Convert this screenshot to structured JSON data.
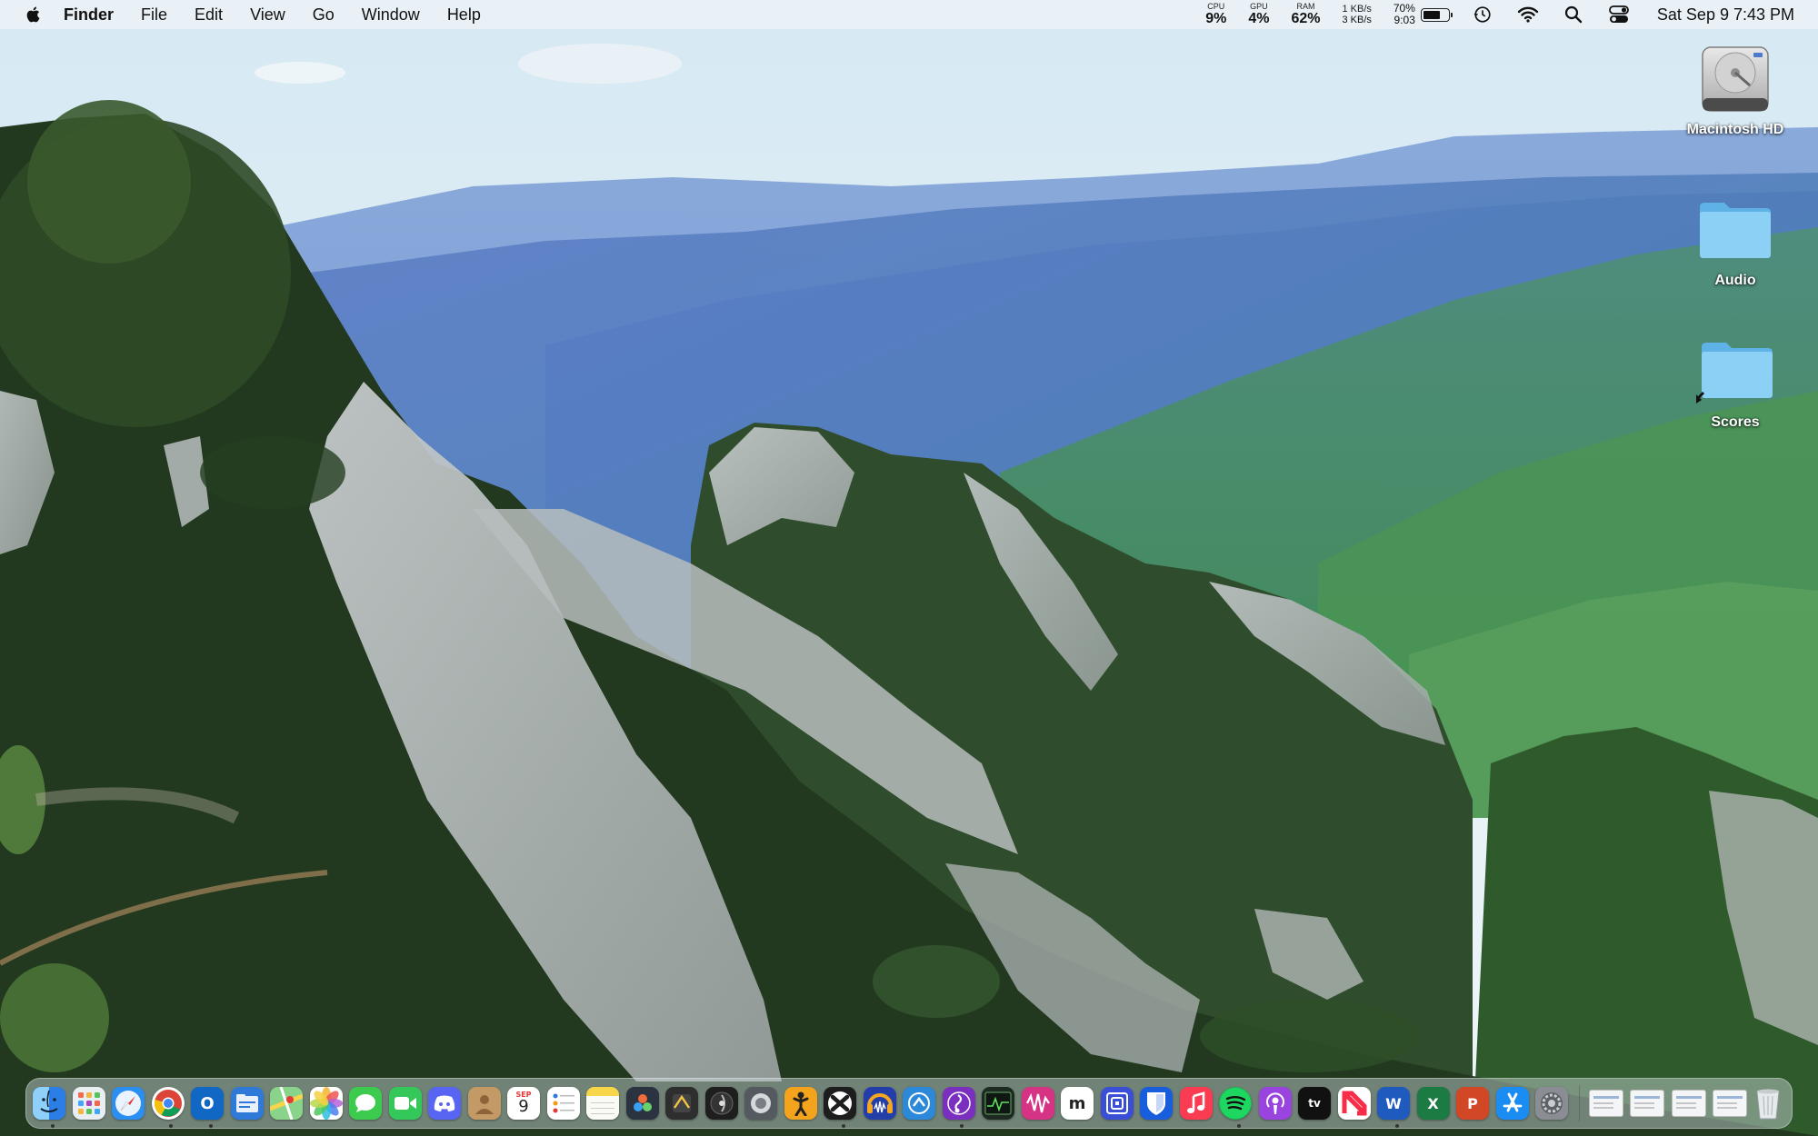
{
  "menubar": {
    "app_name": "Finder",
    "menus": [
      "File",
      "Edit",
      "View",
      "Go",
      "Window",
      "Help"
    ],
    "stats": {
      "cpu_label": "CPU",
      "cpu_value": "9%",
      "gpu_label": "GPU",
      "gpu_value": "4%",
      "ram_label": "RAM",
      "ram_value": "62%",
      "net_up": "1 KB/s",
      "net_down": "3 KB/s",
      "battery_percent": "70%",
      "battery_time": "9:03",
      "battery_level": 0.7
    },
    "icons": [
      "apple-icon",
      "time-machine-icon",
      "wifi-icon",
      "spotlight-search-icon",
      "control-center-icon"
    ],
    "clock": "Sat Sep 9  7:43 PM"
  },
  "desktop": {
    "icons": [
      {
        "label": "Macintosh HD",
        "icon": "hard-drive-icon"
      },
      {
        "label": "Audio",
        "icon": "folder-icon"
      },
      {
        "label": "Scores",
        "icon": "folder-alias-icon"
      }
    ]
  },
  "calendar": {
    "month": "SEP",
    "day": "9"
  },
  "dock": {
    "apps": [
      {
        "name": "finder",
        "icon": "finder-icon",
        "color": "#3d8ce8",
        "running": true
      },
      {
        "name": "launchpad",
        "icon": "launchpad-icon",
        "color": "#e9eef3",
        "running": false
      },
      {
        "name": "safari",
        "icon": "safari-icon",
        "color": "#2a8ff0",
        "running": false
      },
      {
        "name": "chrome",
        "icon": "chrome-icon",
        "color": "#ffffff",
        "running": true
      },
      {
        "name": "outlook",
        "icon": "outlook-icon",
        "color": "#1068c4",
        "running": true
      },
      {
        "name": "files",
        "icon": "files-icon",
        "color": "#2f7ad8",
        "running": false
      },
      {
        "name": "maps",
        "icon": "maps-icon",
        "color": "#6ec06a",
        "running": false
      },
      {
        "name": "photos",
        "icon": "photos-icon",
        "color": "#ffffff",
        "running": false
      },
      {
        "name": "messages",
        "icon": "messages-icon",
        "color": "#3ccb4e",
        "running": false
      },
      {
        "name": "facetime",
        "icon": "facetime-icon",
        "color": "#34c759",
        "running": false
      },
      {
        "name": "discord",
        "icon": "discord-icon",
        "color": "#5865f2",
        "running": false
      },
      {
        "name": "contacts",
        "icon": "contacts-icon",
        "color": "#b88952",
        "running": false
      },
      {
        "name": "calendar",
        "icon": "calendar-icon",
        "color": "#ffffff",
        "running": false
      },
      {
        "name": "reminders",
        "icon": "reminders-icon",
        "color": "#ffffff",
        "running": false
      },
      {
        "name": "notes",
        "icon": "notes-icon",
        "color": "#f7d64a",
        "running": false
      },
      {
        "name": "davinci-resolve",
        "icon": "davinci-resolve-icon",
        "color": "#2b3340",
        "running": false
      },
      {
        "name": "final-cut",
        "icon": "final-cut-icon",
        "color": "#2e2e2e",
        "running": false
      },
      {
        "name": "logic",
        "icon": "logic-icon",
        "color": "#1e1e1e",
        "running": false
      },
      {
        "name": "compressor",
        "icon": "compressor-icon",
        "color": "#555a60",
        "running": false
      },
      {
        "name": "accessibility-app",
        "icon": "figure-icon",
        "color": "#f4a31c",
        "running": false
      },
      {
        "name": "crossover",
        "icon": "crossover-icon",
        "color": "#1d1d1d",
        "running": true
      },
      {
        "name": "audacity",
        "icon": "audacity-icon",
        "color": "#233ea8",
        "running": false
      },
      {
        "name": "migration",
        "icon": "migration-icon",
        "color": "#2c88d9",
        "running": false
      },
      {
        "name": "musescore",
        "icon": "musescore-icon",
        "color": "#7b2fbf",
        "running": true
      },
      {
        "name": "activity-monitor",
        "icon": "activity-monitor-icon",
        "color": "#1d2a22",
        "running": false
      },
      {
        "name": "waveform-app",
        "icon": "waveform-icon",
        "color": "#d63384",
        "running": false
      },
      {
        "name": "miro",
        "icon": "miro-icon",
        "color": "#ffffff",
        "running": false
      },
      {
        "name": "scrobbles",
        "icon": "concentric-square-icon",
        "color": "#3a4fd6",
        "running": false
      },
      {
        "name": "bitwarden",
        "icon": "bitwarden-icon",
        "color": "#175ddc",
        "running": false
      },
      {
        "name": "music",
        "icon": "music-icon",
        "color": "#fa3c52",
        "running": false
      },
      {
        "name": "spotify",
        "icon": "spotify-icon",
        "color": "#1db954",
        "running": true
      },
      {
        "name": "podcasts",
        "icon": "podcasts-icon",
        "color": "#9a44e0",
        "running": false
      },
      {
        "name": "apple-tv",
        "icon": "apple-tv-icon",
        "color": "#111111",
        "running": false
      },
      {
        "name": "news",
        "icon": "news-icon",
        "color": "#ffffff",
        "running": false
      },
      {
        "name": "word",
        "icon": "word-icon",
        "color": "#1f5bbf",
        "running": true
      },
      {
        "name": "excel",
        "icon": "excel-icon",
        "color": "#1c7a43",
        "running": false
      },
      {
        "name": "powerpoint",
        "icon": "powerpoint-icon",
        "color": "#d24726",
        "running": false
      },
      {
        "name": "app-store",
        "icon": "app-store-icon",
        "color": "#1b8df2",
        "running": false
      },
      {
        "name": "system-settings",
        "icon": "system-settings-icon",
        "color": "#8a8e94",
        "running": false
      }
    ],
    "stacks": [
      "downloads-stack",
      "documents-stack",
      "screenshots-stack",
      "files-stack"
    ],
    "trash": "trash-icon"
  }
}
